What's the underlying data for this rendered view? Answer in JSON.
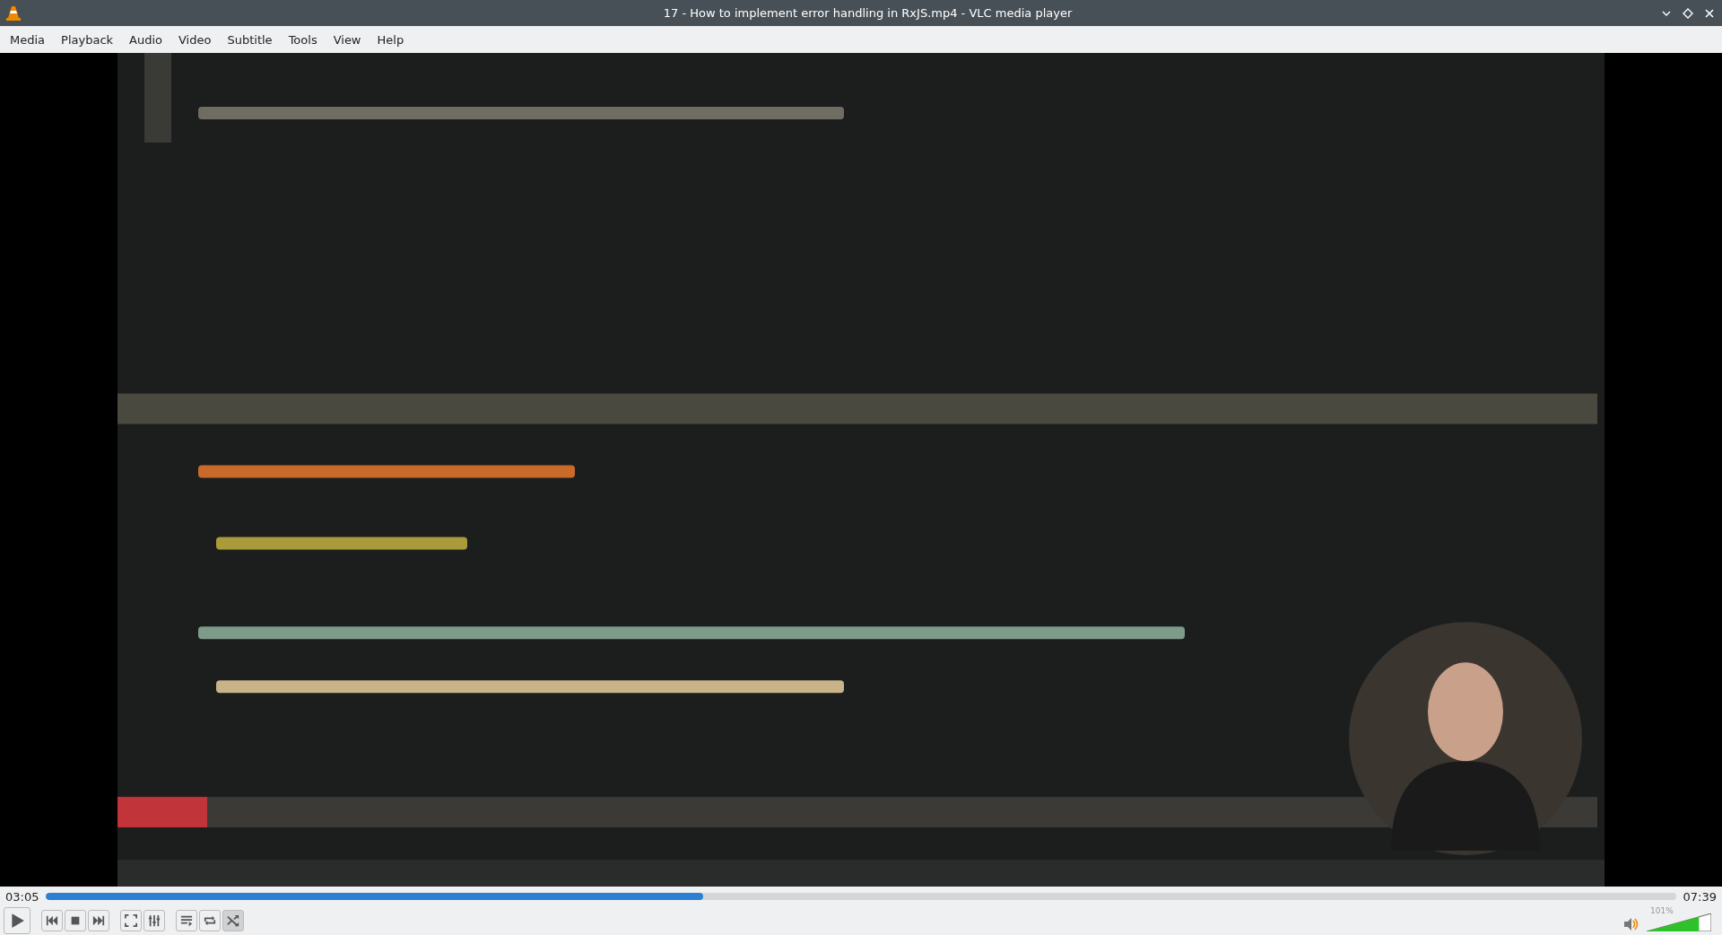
{
  "window": {
    "title": "17 - How to implement error handling in RxJS.mp4 - VLC media player"
  },
  "menu": [
    "Media",
    "Playback",
    "Audio",
    "Video",
    "Subtitle",
    "Tools",
    "View",
    "Help"
  ],
  "video": {
    "kind": "picture"
  },
  "seek": {
    "elapsed": "03:05",
    "total": "07:39",
    "level": 0.403
  },
  "controls": [
    {
      "kind": "play",
      "on": false
    },
    {
      "kind": "prev",
      "on": false
    },
    {
      "kind": "stop",
      "on": false
    },
    {
      "kind": "next",
      "on": false
    },
    {
      "kind": "fullscreen",
      "on": false
    },
    {
      "kind": "settings",
      "on": false
    },
    {
      "kind": "playlist",
      "on": false
    },
    {
      "kind": "loop",
      "on": false
    },
    {
      "kind": "shuffle",
      "on": true
    }
  ],
  "volume": {
    "reading": "101%",
    "level": 0.81
  }
}
